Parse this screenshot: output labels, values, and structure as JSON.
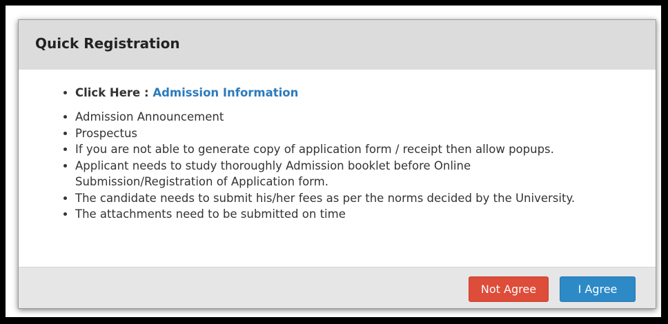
{
  "dialog": {
    "title": "Quick Registration",
    "click_here_label": "Click Here :",
    "click_here_link": "Admission Information",
    "items": [
      "Admission Announcement",
      "Prospectus",
      "If you are not able to generate copy of application form / receipt then allow popups.",
      "Applicant needs to study thoroughly Admission booklet before Online Submission/Registration of Application form.",
      "The candidate needs to submit his/her fees as per the norms decided by the University.",
      "The attachments need to be submitted on time"
    ],
    "buttons": {
      "not_agree": "Not Agree",
      "agree": "I Agree"
    }
  },
  "colors": {
    "header_bg": "#dcdcdc",
    "footer_bg": "#e6e6e6",
    "link": "#2b7bbd",
    "danger": "#de4c3a",
    "primary": "#2d8ac7"
  }
}
